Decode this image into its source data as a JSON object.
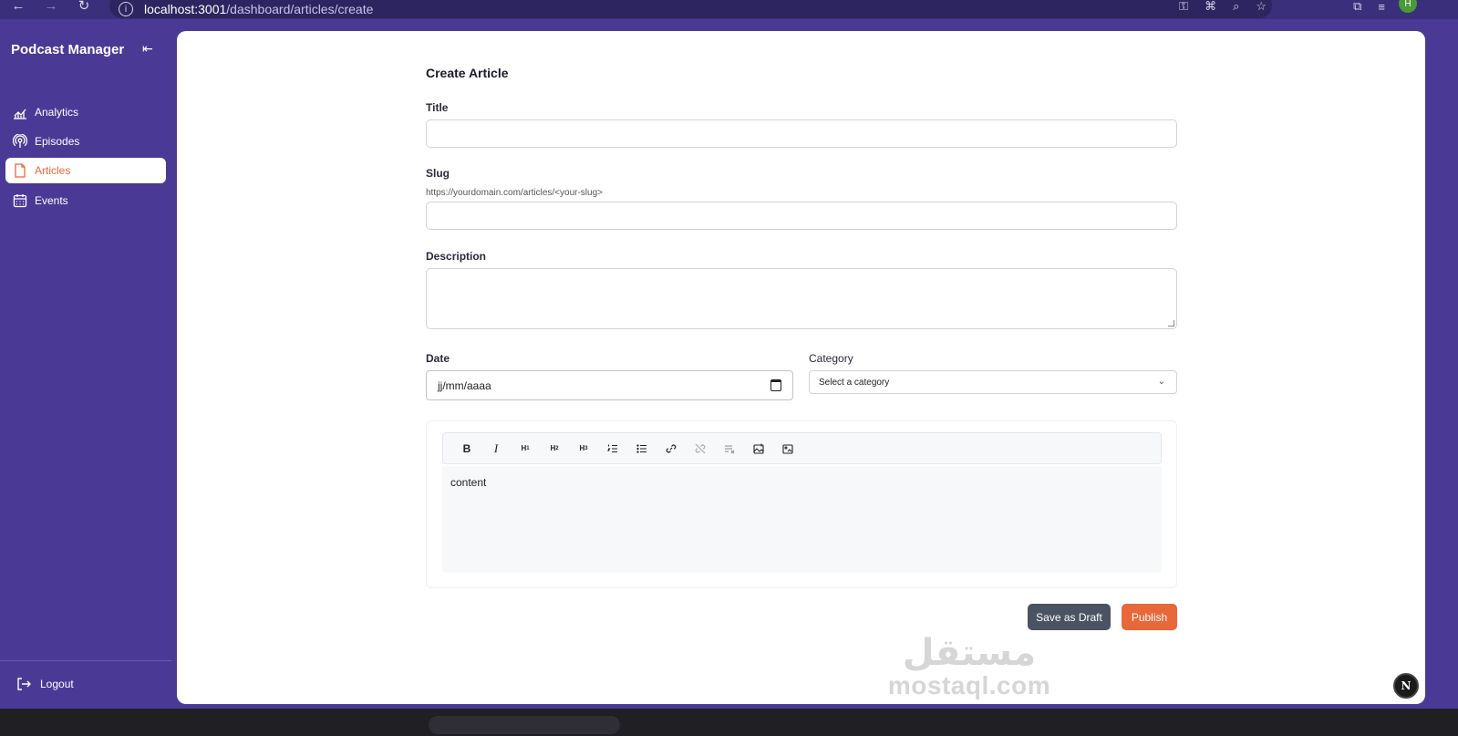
{
  "browser": {
    "url_host": "localhost:3001",
    "url_path": "/dashboard/articles/create",
    "profile_initial": "H"
  },
  "sidebar": {
    "brand": "Podcast Manager",
    "items": [
      {
        "label": "Analytics",
        "icon": "chart-line-icon",
        "active": false
      },
      {
        "label": "Episodes",
        "icon": "podcast-icon",
        "active": false
      },
      {
        "label": "Articles",
        "icon": "file-icon",
        "active": true
      },
      {
        "label": "Events",
        "icon": "calendar-icon",
        "active": false
      }
    ],
    "logout_label": "Logout"
  },
  "form": {
    "title": "Create Article",
    "title_label": "Title",
    "title_value": "",
    "slug_label": "Slug",
    "slug_hint": "https://yourdomain.com/articles/<your-slug>",
    "slug_value": "",
    "description_label": "Description",
    "description_value": "",
    "date_label": "Date",
    "date_placeholder": "jj/mm/aaaa",
    "category_label": "Category",
    "category_selected": "Select a category",
    "editor": {
      "toolbar": [
        "B",
        "I",
        "H1",
        "H2",
        "H3",
        "ordered-list",
        "bullet-list",
        "link",
        "unlink",
        "clear-format",
        "image",
        "image-settings"
      ],
      "content": "content"
    },
    "save_draft_label": "Save as Draft",
    "publish_label": "Publish"
  },
  "colors": {
    "sidebar_bg": "#4a3a96",
    "accent": "#e8683a",
    "draft_button": "#4a5362"
  }
}
